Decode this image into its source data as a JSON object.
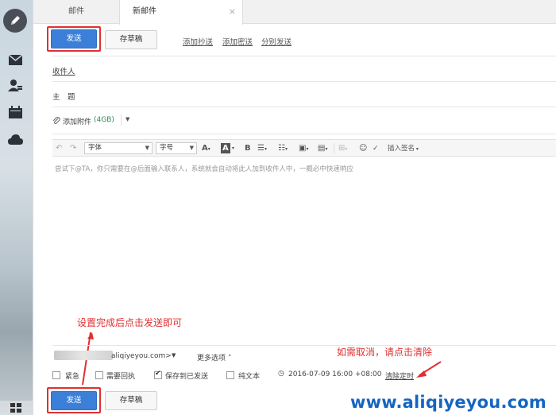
{
  "tabs": {
    "mail": "邮件",
    "new_mail": "新邮件",
    "close": "×"
  },
  "toolbar_top": {
    "send": "发送",
    "save_draft": "存草稿",
    "add_cc": "添加抄送",
    "add_bcc": "添加密送",
    "separate_send": "分别发送"
  },
  "fields": {
    "recipient": "收件人",
    "subject": "主　题",
    "attach": "添加附件",
    "attach_size": "(4GB)"
  },
  "editor": {
    "font_family": "字体",
    "font_size": "字号",
    "insert_signature": "插入签名",
    "placeholder": "尝试下@TA，你只需要在@后面输入联系人，系统就会自动将此人加到收件人中，一概必中快速响应"
  },
  "from": {
    "address_suffix": "aliqiyeyou.com>",
    "more_options": "更多选项"
  },
  "options": {
    "urgent": "紧急",
    "read_receipt": "需要回执",
    "save_sent": "保存到已发送",
    "plain_text": "纯文本",
    "schedule_time": "2016-07-09 16:00 +08:00",
    "clear_schedule": "清除定时"
  },
  "toolbar_bottom": {
    "send": "发送",
    "save_draft": "存草稿"
  },
  "annotations": {
    "left_note": "设置完成后点击发送即可",
    "right_note": "如需取消，请点击清除"
  },
  "watermark": "www.aliqiyeyou.com",
  "colors": {
    "send_blue": "#3b7fd8",
    "annotation_red": "#e03030",
    "watermark_blue": "#1565c0"
  }
}
